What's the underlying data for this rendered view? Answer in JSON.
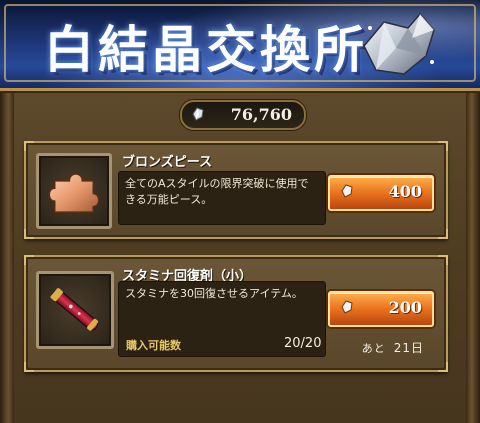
{
  "header": {
    "title": "白結晶交換所",
    "currency_icon": "white-crystal-icon",
    "currency_amount": "76,760"
  },
  "items": [
    {
      "name": "ブロンズピース",
      "description": "全てのAスタイルの限界突破に使用できる万能ピース。",
      "icon": "bronze-puzzle-piece-icon",
      "price": "400"
    },
    {
      "name": "スタミナ回復剤（小）",
      "description": "スタミナを30回復させるアイテム。",
      "icon": "stamina-potion-icon",
      "price": "200",
      "limit_label": "購入可能数",
      "limit_value": "20/20",
      "remaining_label": "あと",
      "remaining_value": "21日"
    }
  ],
  "colors": {
    "banner": "#274a9a",
    "price_button": "#e9721d",
    "limit_label": "#e8c766"
  }
}
